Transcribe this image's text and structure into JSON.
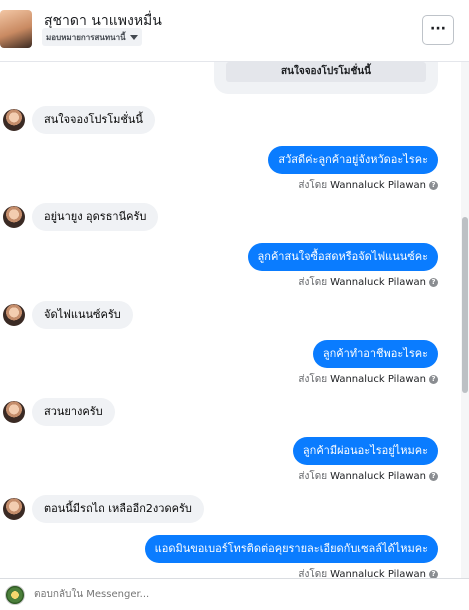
{
  "header": {
    "contact_name": "สุชาดา นาแพงหมื่น",
    "assign_label": "มอบหมายการสนทนานี้",
    "more_label": "···"
  },
  "card": {
    "button_label": "สนใจจองโปรโมชั่นนี้"
  },
  "messages": [
    {
      "dir": "in",
      "text": "สนใจจองโปรโมชั่นนี้"
    },
    {
      "dir": "out",
      "text": "สวัสดีค่ะลูกค้าอยู่จังหวัดอะไรคะ"
    },
    {
      "dir": "in",
      "text": "อยู่นายูง อุดรธานีครับ"
    },
    {
      "dir": "out",
      "text": "ลูกค้าสนใจซื้อสดหรือจัดไฟแนนซ์คะ"
    },
    {
      "dir": "in",
      "text": "จัดไฟแนนซ์ครับ"
    },
    {
      "dir": "out",
      "text": "ลูกค้าทำอาชีพอะไรคะ"
    },
    {
      "dir": "in",
      "text": "สวนยางครับ"
    },
    {
      "dir": "out",
      "text": "ลูกค้ามีผ่อนอะไรอยู่ไหมคะ"
    },
    {
      "dir": "in",
      "text": "ตอนนี้มีรถไถ เหลืออีก2งวดครับ"
    },
    {
      "dir": "out",
      "text": "แอดมินขอเบอร์โทรติดต่อคุยรายละเอียดกับเซลล์ได้ไหมคะ"
    }
  ],
  "sent_by": {
    "prefix": "ส่งโดย",
    "agent": "Wannaluck Pilawan",
    "help_icon": "?"
  },
  "composer": {
    "placeholder": "ตอบกลับใน Messenger..."
  },
  "colors": {
    "outgoing_bubble": "#0a7cff",
    "incoming_bubble": "#f0f2f5"
  }
}
